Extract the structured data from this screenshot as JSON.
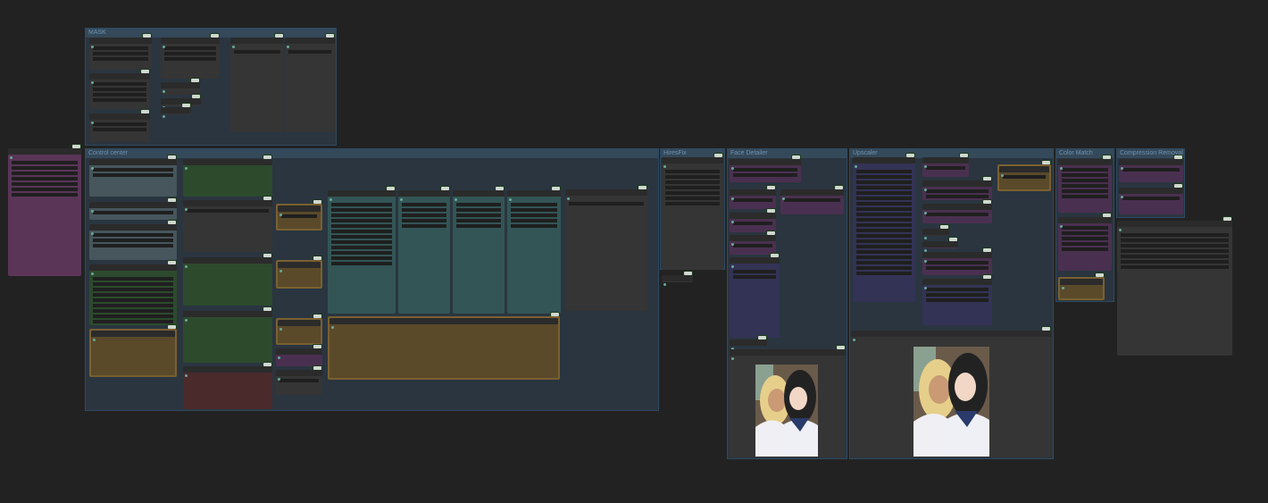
{
  "groups": {
    "mask": "MASK",
    "control_center": "Control center",
    "hiresfix": "HiresFix",
    "face_detailer": "Face Detailer",
    "upscaler": "Upscaler",
    "color_match": "Color Match",
    "compression_removal": "Compression Removal"
  },
  "colors": {
    "canvas": "#222222",
    "group": "#2a3540",
    "node_gray": "#353535",
    "node_green": "#2d4a2d",
    "node_teal": "#335555",
    "node_brown": "#5a4a2a",
    "node_purple": "#4a3050",
    "node_blue": "#333355",
    "node_red": "#4a2a2a"
  }
}
